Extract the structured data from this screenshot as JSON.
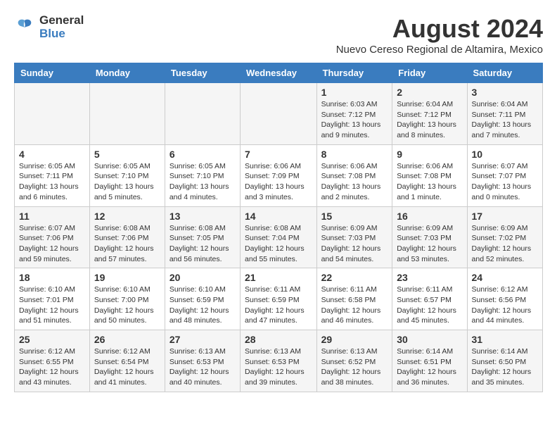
{
  "logo": {
    "general": "General",
    "blue": "Blue"
  },
  "title": {
    "month_year": "August 2024",
    "location": "Nuevo Cereso Regional de Altamira, Mexico"
  },
  "weekdays": [
    "Sunday",
    "Monday",
    "Tuesday",
    "Wednesday",
    "Thursday",
    "Friday",
    "Saturday"
  ],
  "weeks": [
    [
      {
        "day": "",
        "info": ""
      },
      {
        "day": "",
        "info": ""
      },
      {
        "day": "",
        "info": ""
      },
      {
        "day": "",
        "info": ""
      },
      {
        "day": "1",
        "info": "Sunrise: 6:03 AM\nSunset: 7:12 PM\nDaylight: 13 hours\nand 9 minutes."
      },
      {
        "day": "2",
        "info": "Sunrise: 6:04 AM\nSunset: 7:12 PM\nDaylight: 13 hours\nand 8 minutes."
      },
      {
        "day": "3",
        "info": "Sunrise: 6:04 AM\nSunset: 7:11 PM\nDaylight: 13 hours\nand 7 minutes."
      }
    ],
    [
      {
        "day": "4",
        "info": "Sunrise: 6:05 AM\nSunset: 7:11 PM\nDaylight: 13 hours\nand 6 minutes."
      },
      {
        "day": "5",
        "info": "Sunrise: 6:05 AM\nSunset: 7:10 PM\nDaylight: 13 hours\nand 5 minutes."
      },
      {
        "day": "6",
        "info": "Sunrise: 6:05 AM\nSunset: 7:10 PM\nDaylight: 13 hours\nand 4 minutes."
      },
      {
        "day": "7",
        "info": "Sunrise: 6:06 AM\nSunset: 7:09 PM\nDaylight: 13 hours\nand 3 minutes."
      },
      {
        "day": "8",
        "info": "Sunrise: 6:06 AM\nSunset: 7:08 PM\nDaylight: 13 hours\nand 2 minutes."
      },
      {
        "day": "9",
        "info": "Sunrise: 6:06 AM\nSunset: 7:08 PM\nDaylight: 13 hours\nand 1 minute."
      },
      {
        "day": "10",
        "info": "Sunrise: 6:07 AM\nSunset: 7:07 PM\nDaylight: 13 hours\nand 0 minutes."
      }
    ],
    [
      {
        "day": "11",
        "info": "Sunrise: 6:07 AM\nSunset: 7:06 PM\nDaylight: 12 hours\nand 59 minutes."
      },
      {
        "day": "12",
        "info": "Sunrise: 6:08 AM\nSunset: 7:06 PM\nDaylight: 12 hours\nand 57 minutes."
      },
      {
        "day": "13",
        "info": "Sunrise: 6:08 AM\nSunset: 7:05 PM\nDaylight: 12 hours\nand 56 minutes."
      },
      {
        "day": "14",
        "info": "Sunrise: 6:08 AM\nSunset: 7:04 PM\nDaylight: 12 hours\nand 55 minutes."
      },
      {
        "day": "15",
        "info": "Sunrise: 6:09 AM\nSunset: 7:03 PM\nDaylight: 12 hours\nand 54 minutes."
      },
      {
        "day": "16",
        "info": "Sunrise: 6:09 AM\nSunset: 7:03 PM\nDaylight: 12 hours\nand 53 minutes."
      },
      {
        "day": "17",
        "info": "Sunrise: 6:09 AM\nSunset: 7:02 PM\nDaylight: 12 hours\nand 52 minutes."
      }
    ],
    [
      {
        "day": "18",
        "info": "Sunrise: 6:10 AM\nSunset: 7:01 PM\nDaylight: 12 hours\nand 51 minutes."
      },
      {
        "day": "19",
        "info": "Sunrise: 6:10 AM\nSunset: 7:00 PM\nDaylight: 12 hours\nand 50 minutes."
      },
      {
        "day": "20",
        "info": "Sunrise: 6:10 AM\nSunset: 6:59 PM\nDaylight: 12 hours\nand 48 minutes."
      },
      {
        "day": "21",
        "info": "Sunrise: 6:11 AM\nSunset: 6:59 PM\nDaylight: 12 hours\nand 47 minutes."
      },
      {
        "day": "22",
        "info": "Sunrise: 6:11 AM\nSunset: 6:58 PM\nDaylight: 12 hours\nand 46 minutes."
      },
      {
        "day": "23",
        "info": "Sunrise: 6:11 AM\nSunset: 6:57 PM\nDaylight: 12 hours\nand 45 minutes."
      },
      {
        "day": "24",
        "info": "Sunrise: 6:12 AM\nSunset: 6:56 PM\nDaylight: 12 hours\nand 44 minutes."
      }
    ],
    [
      {
        "day": "25",
        "info": "Sunrise: 6:12 AM\nSunset: 6:55 PM\nDaylight: 12 hours\nand 43 minutes."
      },
      {
        "day": "26",
        "info": "Sunrise: 6:12 AM\nSunset: 6:54 PM\nDaylight: 12 hours\nand 41 minutes."
      },
      {
        "day": "27",
        "info": "Sunrise: 6:13 AM\nSunset: 6:53 PM\nDaylight: 12 hours\nand 40 minutes."
      },
      {
        "day": "28",
        "info": "Sunrise: 6:13 AM\nSunset: 6:53 PM\nDaylight: 12 hours\nand 39 minutes."
      },
      {
        "day": "29",
        "info": "Sunrise: 6:13 AM\nSunset: 6:52 PM\nDaylight: 12 hours\nand 38 minutes."
      },
      {
        "day": "30",
        "info": "Sunrise: 6:14 AM\nSunset: 6:51 PM\nDaylight: 12 hours\nand 36 minutes."
      },
      {
        "day": "31",
        "info": "Sunrise: 6:14 AM\nSunset: 6:50 PM\nDaylight: 12 hours\nand 35 minutes."
      }
    ]
  ]
}
